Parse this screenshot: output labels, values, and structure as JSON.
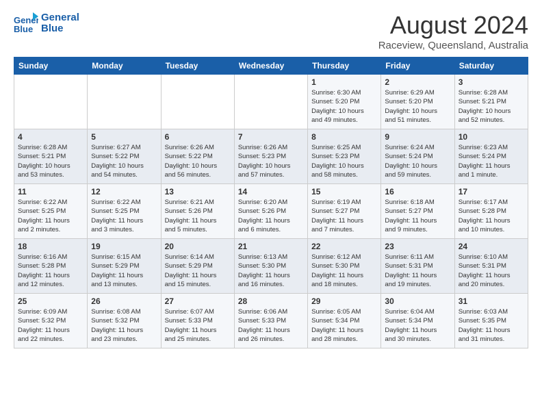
{
  "logo": {
    "line1": "General",
    "line2": "Blue"
  },
  "title": "August 2024",
  "location": "Raceview, Queensland, Australia",
  "days_of_week": [
    "Sunday",
    "Monday",
    "Tuesday",
    "Wednesday",
    "Thursday",
    "Friday",
    "Saturday"
  ],
  "weeks": [
    [
      {
        "day": "",
        "text": ""
      },
      {
        "day": "",
        "text": ""
      },
      {
        "day": "",
        "text": ""
      },
      {
        "day": "",
        "text": ""
      },
      {
        "day": "1",
        "text": "Sunrise: 6:30 AM\nSunset: 5:20 PM\nDaylight: 10 hours\nand 49 minutes."
      },
      {
        "day": "2",
        "text": "Sunrise: 6:29 AM\nSunset: 5:20 PM\nDaylight: 10 hours\nand 51 minutes."
      },
      {
        "day": "3",
        "text": "Sunrise: 6:28 AM\nSunset: 5:21 PM\nDaylight: 10 hours\nand 52 minutes."
      }
    ],
    [
      {
        "day": "4",
        "text": "Sunrise: 6:28 AM\nSunset: 5:21 PM\nDaylight: 10 hours\nand 53 minutes."
      },
      {
        "day": "5",
        "text": "Sunrise: 6:27 AM\nSunset: 5:22 PM\nDaylight: 10 hours\nand 54 minutes."
      },
      {
        "day": "6",
        "text": "Sunrise: 6:26 AM\nSunset: 5:22 PM\nDaylight: 10 hours\nand 56 minutes."
      },
      {
        "day": "7",
        "text": "Sunrise: 6:26 AM\nSunset: 5:23 PM\nDaylight: 10 hours\nand 57 minutes."
      },
      {
        "day": "8",
        "text": "Sunrise: 6:25 AM\nSunset: 5:23 PM\nDaylight: 10 hours\nand 58 minutes."
      },
      {
        "day": "9",
        "text": "Sunrise: 6:24 AM\nSunset: 5:24 PM\nDaylight: 10 hours\nand 59 minutes."
      },
      {
        "day": "10",
        "text": "Sunrise: 6:23 AM\nSunset: 5:24 PM\nDaylight: 11 hours\nand 1 minute."
      }
    ],
    [
      {
        "day": "11",
        "text": "Sunrise: 6:22 AM\nSunset: 5:25 PM\nDaylight: 11 hours\nand 2 minutes."
      },
      {
        "day": "12",
        "text": "Sunrise: 6:22 AM\nSunset: 5:25 PM\nDaylight: 11 hours\nand 3 minutes."
      },
      {
        "day": "13",
        "text": "Sunrise: 6:21 AM\nSunset: 5:26 PM\nDaylight: 11 hours\nand 5 minutes."
      },
      {
        "day": "14",
        "text": "Sunrise: 6:20 AM\nSunset: 5:26 PM\nDaylight: 11 hours\nand 6 minutes."
      },
      {
        "day": "15",
        "text": "Sunrise: 6:19 AM\nSunset: 5:27 PM\nDaylight: 11 hours\nand 7 minutes."
      },
      {
        "day": "16",
        "text": "Sunrise: 6:18 AM\nSunset: 5:27 PM\nDaylight: 11 hours\nand 9 minutes."
      },
      {
        "day": "17",
        "text": "Sunrise: 6:17 AM\nSunset: 5:28 PM\nDaylight: 11 hours\nand 10 minutes."
      }
    ],
    [
      {
        "day": "18",
        "text": "Sunrise: 6:16 AM\nSunset: 5:28 PM\nDaylight: 11 hours\nand 12 minutes."
      },
      {
        "day": "19",
        "text": "Sunrise: 6:15 AM\nSunset: 5:29 PM\nDaylight: 11 hours\nand 13 minutes."
      },
      {
        "day": "20",
        "text": "Sunrise: 6:14 AM\nSunset: 5:29 PM\nDaylight: 11 hours\nand 15 minutes."
      },
      {
        "day": "21",
        "text": "Sunrise: 6:13 AM\nSunset: 5:30 PM\nDaylight: 11 hours\nand 16 minutes."
      },
      {
        "day": "22",
        "text": "Sunrise: 6:12 AM\nSunset: 5:30 PM\nDaylight: 11 hours\nand 18 minutes."
      },
      {
        "day": "23",
        "text": "Sunrise: 6:11 AM\nSunset: 5:31 PM\nDaylight: 11 hours\nand 19 minutes."
      },
      {
        "day": "24",
        "text": "Sunrise: 6:10 AM\nSunset: 5:31 PM\nDaylight: 11 hours\nand 20 minutes."
      }
    ],
    [
      {
        "day": "25",
        "text": "Sunrise: 6:09 AM\nSunset: 5:32 PM\nDaylight: 11 hours\nand 22 minutes."
      },
      {
        "day": "26",
        "text": "Sunrise: 6:08 AM\nSunset: 5:32 PM\nDaylight: 11 hours\nand 23 minutes."
      },
      {
        "day": "27",
        "text": "Sunrise: 6:07 AM\nSunset: 5:33 PM\nDaylight: 11 hours\nand 25 minutes."
      },
      {
        "day": "28",
        "text": "Sunrise: 6:06 AM\nSunset: 5:33 PM\nDaylight: 11 hours\nand 26 minutes."
      },
      {
        "day": "29",
        "text": "Sunrise: 6:05 AM\nSunset: 5:34 PM\nDaylight: 11 hours\nand 28 minutes."
      },
      {
        "day": "30",
        "text": "Sunrise: 6:04 AM\nSunset: 5:34 PM\nDaylight: 11 hours\nand 30 minutes."
      },
      {
        "day": "31",
        "text": "Sunrise: 6:03 AM\nSunset: 5:35 PM\nDaylight: 11 hours\nand 31 minutes."
      }
    ]
  ]
}
